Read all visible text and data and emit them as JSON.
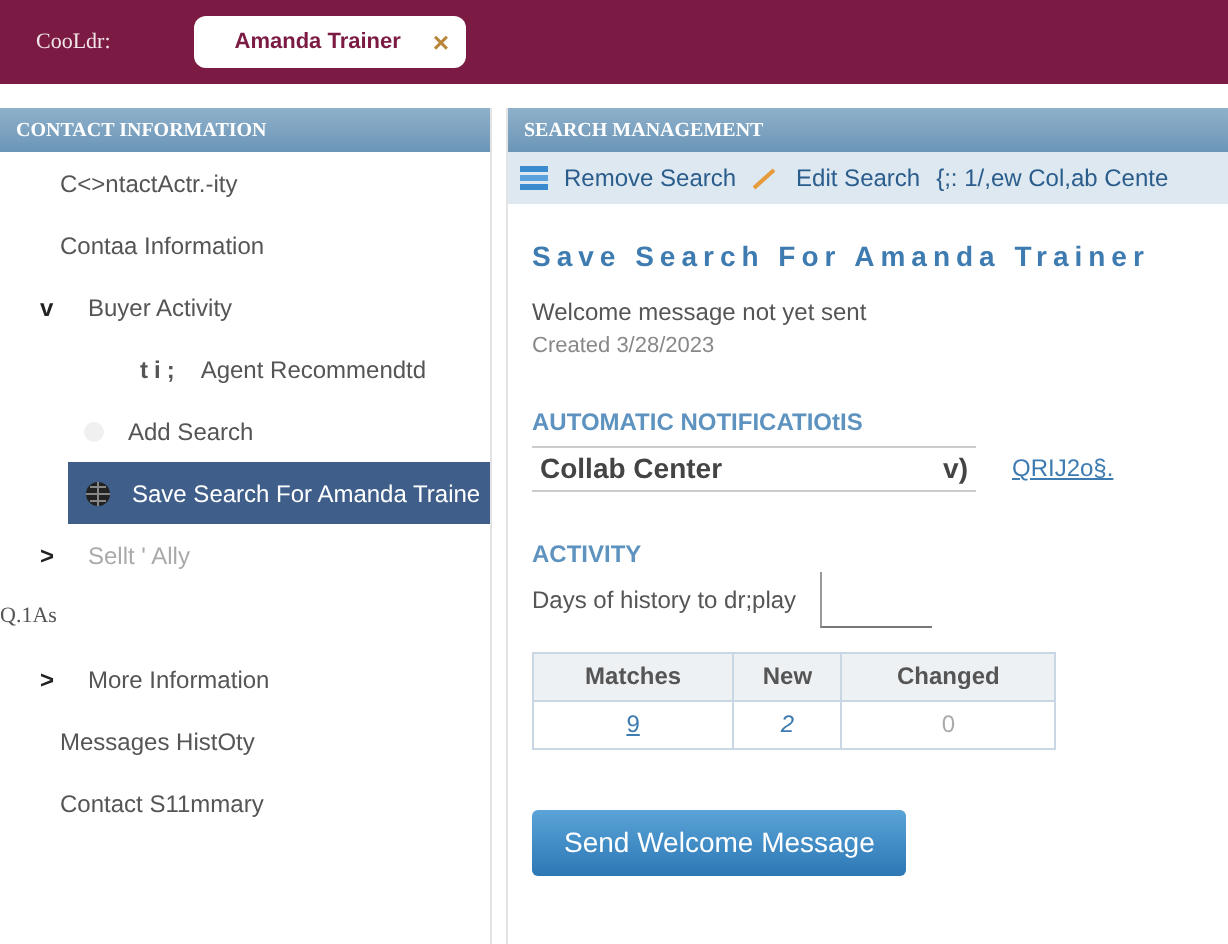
{
  "top_bar": {
    "label": "CooLdr:",
    "tabs": [
      {
        "label": "Amanda Trainer",
        "close": "×",
        "selected": true
      }
    ]
  },
  "sidebar": {
    "title": "CONTACT INFORMATION",
    "items": [
      {
        "label": "C<>ntactActr.-ity",
        "selected": false
      },
      {
        "label": "Contaa Information",
        "selected": false
      },
      {
        "label": "Buyer Activity",
        "toggle": "v",
        "selected": false,
        "children": [
          {
            "label": "Agent Recommendtd",
            "prefix": "ti;",
            "selected": false
          },
          {
            "label": "Add Search",
            "selected": false
          },
          {
            "label": "Save Search For Amanda Traine",
            "selected": true
          }
        ]
      },
      {
        "label": "Sellt ' Ally",
        "toggle": ">",
        "faded": true,
        "selected": false
      },
      {
        "label": "Q.1As",
        "kind": "caption",
        "selected": false
      },
      {
        "label": "More Information",
        "toggle": ">",
        "selected": false
      },
      {
        "label": "Messages HistOty",
        "selected": false
      },
      {
        "label": "Contact S11mmary",
        "selected": false
      }
    ]
  },
  "main": {
    "title": "SEARCH MANAGEMENT",
    "toolbar": [
      {
        "label": "Remove Search"
      },
      {
        "label": "Edit Search"
      },
      {
        "label": "{;: 1/,ew Col,ab Cente"
      }
    ],
    "heading": "Save Search For Amanda Trainer",
    "status": "Welcome message not yet sent",
    "created": "Created 3/28/2023",
    "notifications": {
      "title": "AUTOMATIC NOTIFICATIOtIS",
      "select_value": "Collab Center",
      "caret": "v)",
      "link": "QRIJ2o§."
    },
    "activity": {
      "title": "ACTIVITY",
      "days_label": "Days of history to dr;play"
    },
    "table": {
      "columns": [
        "Matches",
        "New",
        "Changed"
      ],
      "rows": [
        [
          "9",
          "2",
          "0"
        ]
      ]
    },
    "button": "Send Welcome Message"
  }
}
